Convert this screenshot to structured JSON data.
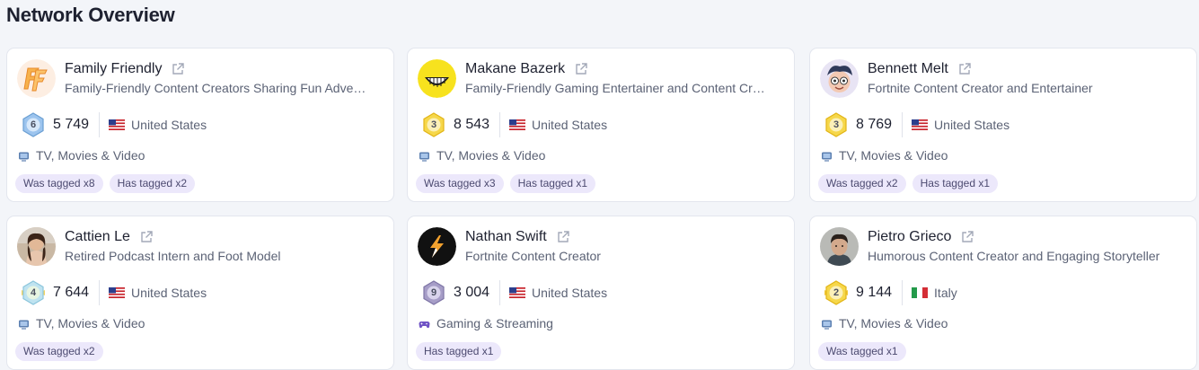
{
  "page": {
    "title": "Network Overview"
  },
  "cards": [
    {
      "name": "Family Friendly",
      "description": "Family-Friendly Content Creators Sharing Fun Adve…",
      "avatar": "family-friendly-logo-avatar",
      "badge": {
        "level": "6",
        "style": "blue"
      },
      "count": "5 749",
      "country": "United States",
      "flag": "us-flag-icon",
      "category": "TV, Movies & Video",
      "category_icon": "tv-icon",
      "tags": [
        "Was tagged x8",
        "Has tagged x2"
      ]
    },
    {
      "name": "Makane Bazerk",
      "description": "Family-Friendly Gaming Entertainer and Content Cr…",
      "avatar": "yellow-smiley-avatar",
      "badge": {
        "level": "3",
        "style": "gold"
      },
      "count": "8 543",
      "country": "United States",
      "flag": "us-flag-icon",
      "category": "TV, Movies & Video",
      "category_icon": "tv-icon",
      "tags": [
        "Was tagged x3",
        "Has tagged x1"
      ]
    },
    {
      "name": "Bennett Melt",
      "description": "Fortnite Content Creator and Entertainer",
      "avatar": "cartoon-avatar",
      "badge": {
        "level": "3",
        "style": "gold"
      },
      "count": "8 769",
      "country": "United States",
      "flag": "us-flag-icon",
      "category": "TV, Movies & Video",
      "category_icon": "tv-icon",
      "tags": [
        "Was tagged x2",
        "Has tagged x1"
      ]
    },
    {
      "name": "Cattien Le",
      "description": "Retired Podcast Intern and Foot Model",
      "avatar": "photo-avatar",
      "badge": {
        "level": "4",
        "style": "holo"
      },
      "count": "7 644",
      "country": "United States",
      "flag": "us-flag-icon",
      "category": "TV, Movies & Video",
      "category_icon": "tv-icon",
      "tags": [
        "Was tagged x2"
      ]
    },
    {
      "name": "Nathan Swift",
      "description": "Fortnite Content Creator",
      "avatar": "black-logo-avatar",
      "badge": {
        "level": "9",
        "style": "purple"
      },
      "count": "3 004",
      "country": "United States",
      "flag": "us-flag-icon",
      "category": "Gaming & Streaming",
      "category_icon": "gamepad-icon",
      "tags": [
        "Has tagged x1"
      ]
    },
    {
      "name": "Pietro Grieco",
      "description": "Humorous Content Creator and Engaging Storyteller",
      "avatar": "photo-avatar-2",
      "badge": {
        "level": "2",
        "style": "gold-wing"
      },
      "count": "9 144",
      "country": "Italy",
      "flag": "it-flag-icon",
      "category": "TV, Movies & Video",
      "category_icon": "tv-icon",
      "tags": [
        "Was tagged x1"
      ]
    }
  ],
  "colors": {
    "tag_bg": "#ece8fb",
    "badge_blue": "#7fb2e6",
    "badge_gold": "#f4cf3a",
    "badge_purple": "#8f86b4"
  }
}
